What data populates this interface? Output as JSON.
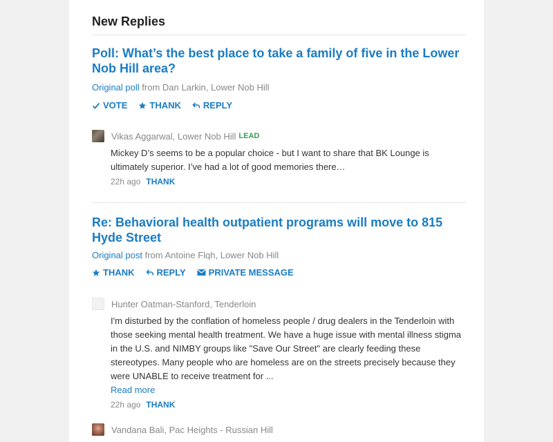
{
  "section": {
    "title": "New Replies"
  },
  "posts": [
    {
      "title": "Poll: What’s the best place to take a family of five in the Lower Nob Hill area?",
      "origin_link": "Original poll",
      "origin_rest": "from Dan Larkin, Lower Nob Hill",
      "actions": {
        "vote": "VOTE",
        "thank": "THANK",
        "reply": "REPLY"
      },
      "reply": {
        "author": "Vikas Aggarwal, Lower Nob Hill",
        "badge": "LEAD",
        "body": "Mickey D’s seems to be a popular choice - but I want to share that BK Lounge is ultimately superior. I’ve had a lot of good memories there…",
        "time": "22h ago",
        "thank": "THANK"
      }
    },
    {
      "title": "Re: Behavioral health outpatient programs will move to 815 Hyde Street",
      "origin_link": "Original post",
      "origin_rest": "from Antoine Flqh, Lower Nob Hill",
      "actions": {
        "thank": "THANK",
        "reply": "REPLY",
        "message": "PRIVATE MESSAGE"
      },
      "reply": {
        "author": "Hunter Oatman-Stanford, Tenderloin",
        "body": "I'm disturbed by the conflation of homeless people / drug dealers in the Tenderloin with those seeking mental health treatment. We have a huge issue with mental illness stigma in the U.S. and NIMBY groups like \"Save Our Street\" are clearly feeding these stereotypes. Many people who are homeless are on the streets precisely because they were UNABLE to receive treatment for ...",
        "read_more": "Read more",
        "time": "22h ago",
        "thank": "THANK"
      },
      "next_reply": {
        "author": "Vandana Bali, Pac Heights - Russian Hill"
      }
    }
  ],
  "icons": {
    "check": "check-icon",
    "star": "star-icon",
    "reply": "reply-arrow-icon",
    "mail": "envelope-icon"
  },
  "colors": {
    "link": "#1a7cc4",
    "lead": "#3a9a55",
    "muted": "#888888"
  }
}
